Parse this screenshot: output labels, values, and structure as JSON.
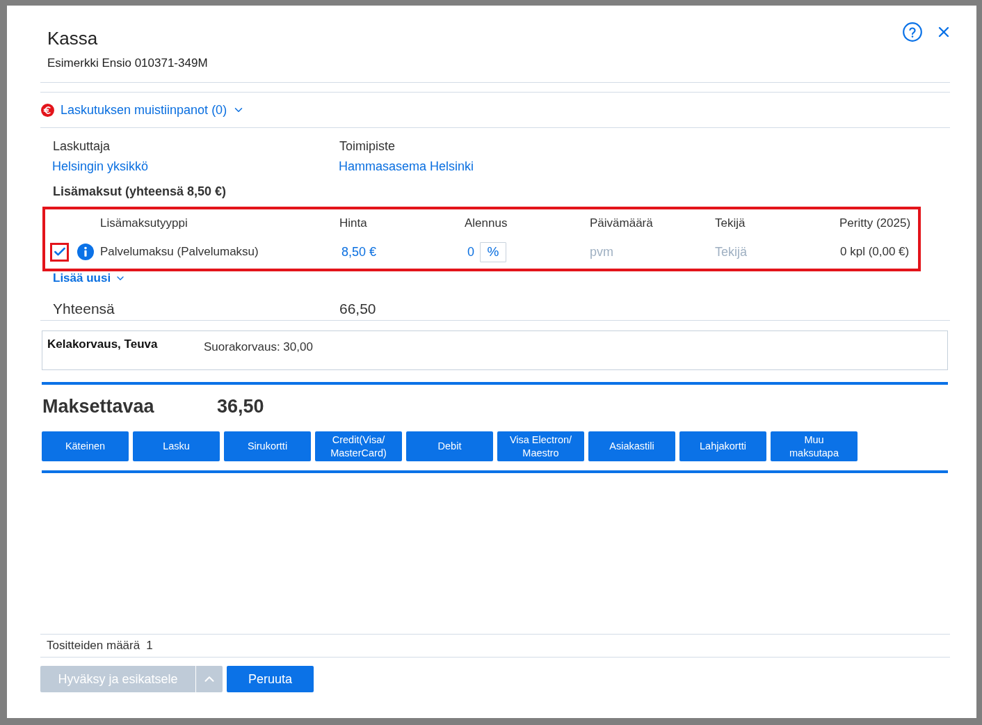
{
  "dialog": {
    "title": "Kassa",
    "subtitle": "Esimerkki Ensio 010371-349M"
  },
  "billing_notes": {
    "label": "Laskutuksen muistiinpanot (0)",
    "expanded": false
  },
  "details": [
    {
      "label": "Laskuttaja",
      "value": "Helsingin yksikkö"
    },
    {
      "label": "Toimipiste",
      "value": "Hammasasema Helsinki"
    }
  ],
  "extra_fees": {
    "title": "Lisämaksut (yhteensä 8,50 €)",
    "highlighted": true,
    "columns": [
      "Lisämaksutyyppi",
      "Hinta",
      "Alennus",
      "Päivämäärä",
      "Tekijä",
      "Peritty (2025)"
    ],
    "rows": [
      {
        "checked": true,
        "checkbox_highlighted": true,
        "type": "Palvelumaksu (Palvelumaksu)",
        "price": "8,50 €",
        "discount": "0",
        "discount_unit": "%",
        "date_placeholder": "pvm",
        "performer_placeholder": "Tekijä",
        "charged": "0 kpl (0,00 €)"
      }
    ],
    "add_new": "Lisää uusi"
  },
  "total": {
    "label": "Yhteensä",
    "value": "66,50"
  },
  "reimbursement": {
    "name": "Kelakorvaus, Teuva",
    "detail": "Suorakorvaus: 30,00"
  },
  "payable": {
    "label": "Maksettavaa",
    "value": "36,50"
  },
  "payment_methods": [
    "Käteinen",
    "Lasku",
    "Sirukortti",
    "Credit(Visa/ MasterCard)",
    "Debit",
    "Visa Electron/ Maestro",
    "Asiakastili",
    "Lahjakortti",
    "Muu maksutapa"
  ],
  "footer": {
    "count_label": "Tositteiden määrä",
    "count_value": "1",
    "approve": {
      "label": "Hyväksy ja esikatsele",
      "disabled": true
    },
    "cancel": "Peruuta"
  }
}
